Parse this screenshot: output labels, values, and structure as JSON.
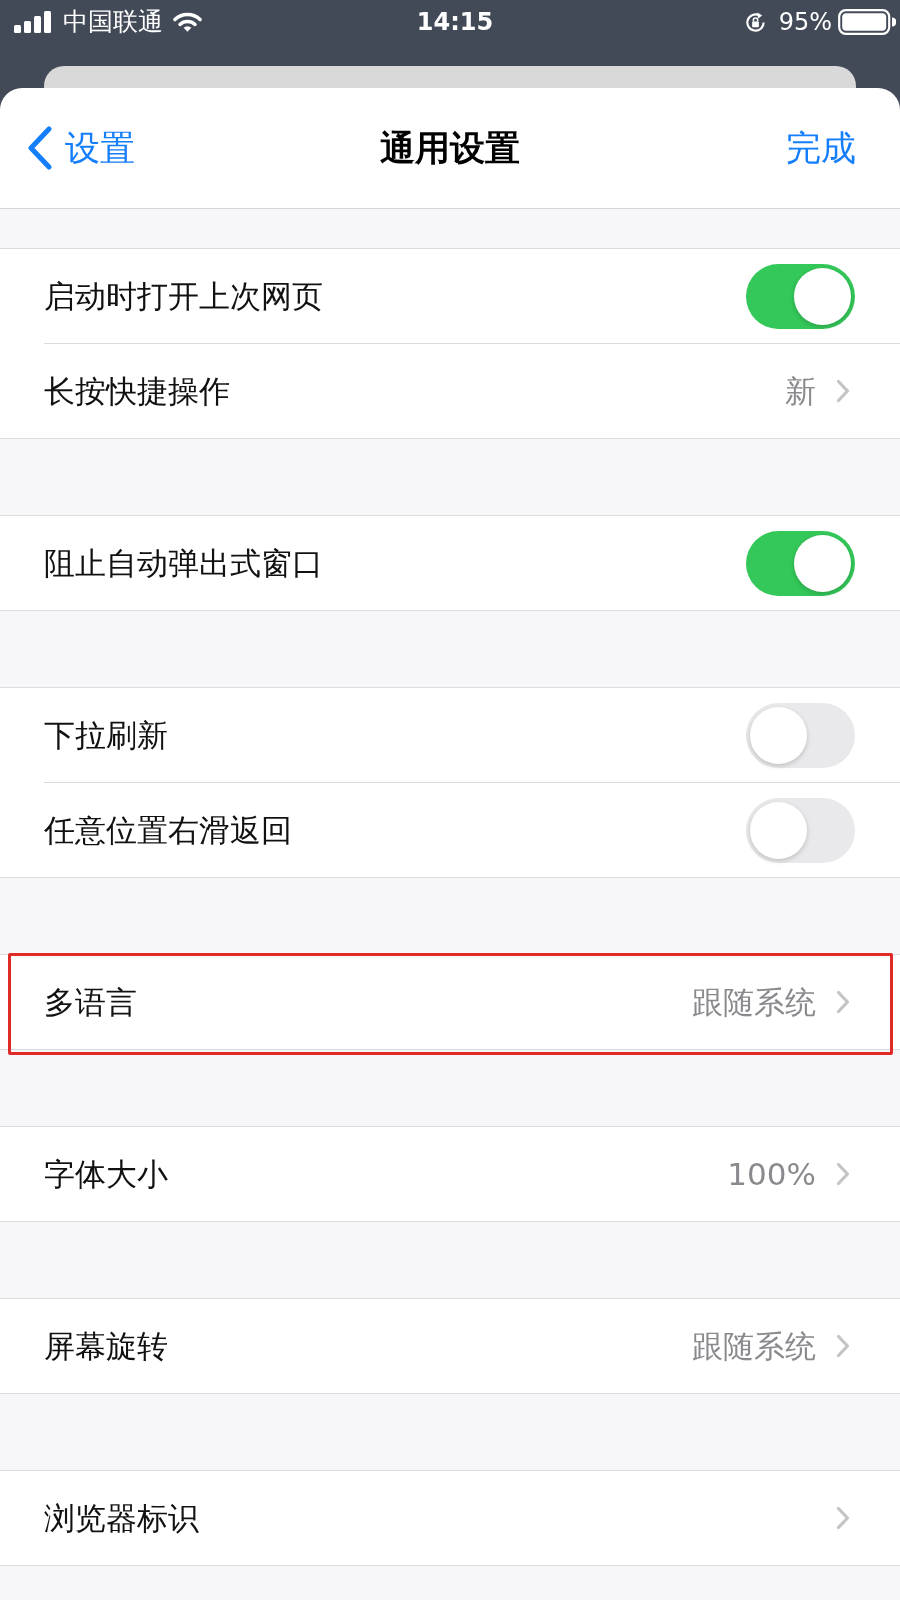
{
  "status_bar": {
    "carrier": "中国联通",
    "time": "14:15",
    "battery": "95%"
  },
  "nav_bar": {
    "back": "设置",
    "title": "通用设置",
    "done": "完成"
  },
  "groups": [
    {
      "rows": [
        {
          "kind": "toggle",
          "label": "启动时打开上次网页",
          "on": true,
          "highlighted": false
        },
        {
          "kind": "link",
          "label": "长按快捷操作",
          "value": "新",
          "highlighted": false
        }
      ]
    },
    {
      "rows": [
        {
          "kind": "toggle",
          "label": "阻止自动弹出式窗口",
          "on": true,
          "highlighted": false
        }
      ]
    },
    {
      "rows": [
        {
          "kind": "toggle",
          "label": "下拉刷新",
          "on": false,
          "highlighted": false
        },
        {
          "kind": "toggle",
          "label": "任意位置右滑返回",
          "on": false,
          "highlighted": false
        }
      ]
    },
    {
      "rows": [
        {
          "kind": "link",
          "label": "多语言",
          "value": "跟随系统",
          "highlighted": true
        }
      ]
    },
    {
      "rows": [
        {
          "kind": "link",
          "label": "字体大小",
          "value": "100%",
          "highlighted": false
        }
      ]
    },
    {
      "rows": [
        {
          "kind": "link",
          "label": "屏幕旋转",
          "value": "跟随系统",
          "highlighted": false
        }
      ]
    },
    {
      "rows": [
        {
          "kind": "link",
          "label": "浏览器标识",
          "highlighted": false
        }
      ]
    }
  ]
}
